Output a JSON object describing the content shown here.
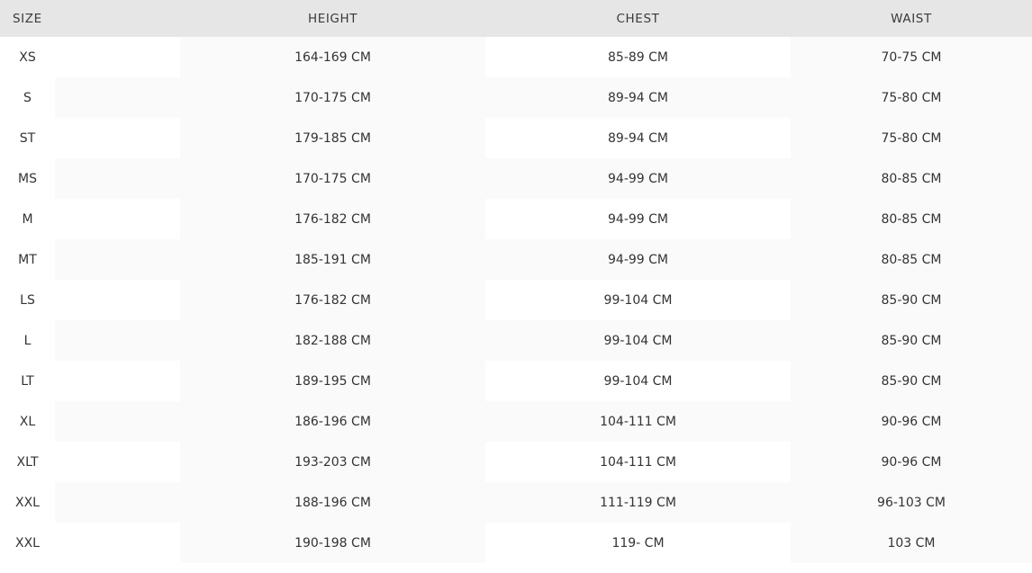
{
  "table": {
    "headers": {
      "size": "SIZE",
      "height": "HEIGHT",
      "chest": "CHEST",
      "waist": "WAIST"
    },
    "rows": [
      {
        "size": "XS",
        "height": "164-169 CM",
        "chest": "85-89 CM",
        "waist": "70-75 CM"
      },
      {
        "size": "S",
        "height": "170-175 CM",
        "chest": "89-94 CM",
        "waist": "75-80 CM"
      },
      {
        "size": "ST",
        "height": "179-185 CM",
        "chest": "89-94 CM",
        "waist": "75-80 CM"
      },
      {
        "size": "MS",
        "height": "170-175 CM",
        "chest": "94-99 CM",
        "waist": "80-85 CM"
      },
      {
        "size": "M",
        "height": "176-182 CM",
        "chest": "94-99 CM",
        "waist": "80-85 CM"
      },
      {
        "size": "MT",
        "height": "185-191 CM",
        "chest": "94-99 CM",
        "waist": "80-85 CM"
      },
      {
        "size": "LS",
        "height": "176-182 CM",
        "chest": "99-104 CM",
        "waist": "85-90 CM"
      },
      {
        "size": "L",
        "height": "182-188 CM",
        "chest": "99-104 CM",
        "waist": "85-90 CM"
      },
      {
        "size": "LT",
        "height": "189-195 CM",
        "chest": "99-104 CM",
        "waist": "85-90 CM"
      },
      {
        "size": "XL",
        "height": "186-196 CM",
        "chest": "104-111 CM",
        "waist": "90-96 CM"
      },
      {
        "size": "XLT",
        "height": "193-203 CM",
        "chest": "104-111 CM",
        "waist": "90-96 CM"
      },
      {
        "size": "XXL",
        "height": "188-196 CM",
        "chest": "111-119 CM",
        "waist": "96-103 CM"
      },
      {
        "size": "XXL",
        "height": "190-198 CM",
        "chest": "119- CM",
        "waist": "103 CM"
      }
    ]
  },
  "colors": {
    "header_background": "#e6e6e6",
    "row_shade": "#fafafa",
    "text": "#333333"
  }
}
